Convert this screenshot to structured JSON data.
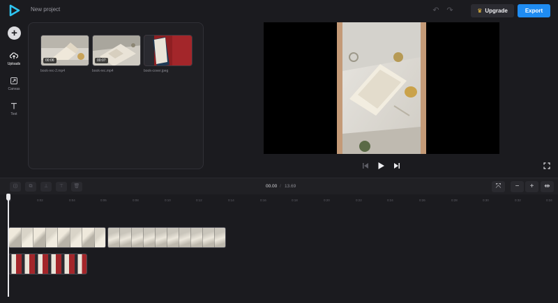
{
  "header": {
    "project_name": "New project",
    "upgrade_label": "Upgrade",
    "export_label": "Export",
    "brand_color": "#1f8cf2"
  },
  "rail": {
    "items": [
      {
        "label": "Uploads",
        "icon": "upload-cloud-icon",
        "active": true
      },
      {
        "label": "Canvas",
        "icon": "canvas-resize-icon",
        "active": false
      },
      {
        "label": "Text",
        "icon": "text-icon",
        "active": false
      }
    ]
  },
  "media": {
    "items": [
      {
        "name": "book-rec-2.mp4",
        "duration": "00:06",
        "kind": "video"
      },
      {
        "name": "book-rec.mp4",
        "duration": "00:07",
        "kind": "video"
      },
      {
        "name": "book-cover.jpeg",
        "duration": "",
        "kind": "image"
      }
    ]
  },
  "timeline": {
    "current_time": "00.00",
    "separator": "/",
    "total_time": "13.69",
    "ruler_ticks": [
      "0",
      "0:02",
      "0:04",
      "0:06",
      "0:08",
      "0:10",
      "0:12",
      "0:14",
      "0:16",
      "0:18",
      "0:20",
      "0:22",
      "0:24",
      "0:26",
      "0:28",
      "0:30",
      "0:32",
      "0:34"
    ],
    "zoom_out_label": "−",
    "zoom_in_label": "+"
  }
}
